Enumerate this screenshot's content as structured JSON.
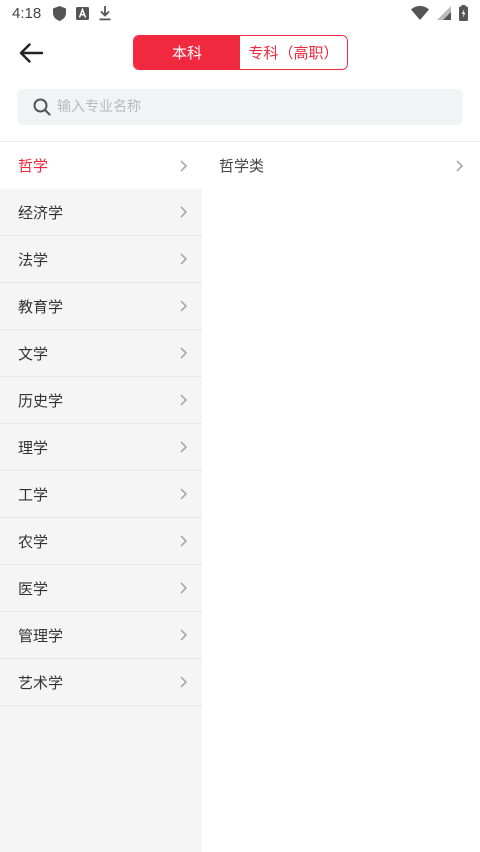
{
  "status_bar": {
    "time": "4:18",
    "left_icons": [
      "shield-icon",
      "a-badge-icon",
      "download-icon"
    ],
    "right_icons": [
      "wifi-icon",
      "signal-icon",
      "battery-icon"
    ]
  },
  "header": {
    "back_icon": "arrow-left-icon",
    "tabs": [
      {
        "label": "本科",
        "active": true
      },
      {
        "label": "专科（高职）",
        "active": false
      }
    ]
  },
  "search": {
    "placeholder": "输入专业名称",
    "value": ""
  },
  "categories": [
    {
      "label": "哲学",
      "selected": true
    },
    {
      "label": "经济学",
      "selected": false
    },
    {
      "label": "法学",
      "selected": false
    },
    {
      "label": "教育学",
      "selected": false
    },
    {
      "label": "文学",
      "selected": false
    },
    {
      "label": "历史学",
      "selected": false
    },
    {
      "label": "理学",
      "selected": false
    },
    {
      "label": "工学",
      "selected": false
    },
    {
      "label": "农学",
      "selected": false
    },
    {
      "label": "医学",
      "selected": false
    },
    {
      "label": "管理学",
      "selected": false
    },
    {
      "label": "艺术学",
      "selected": false
    }
  ],
  "subcategories": [
    {
      "label": "哲学类"
    }
  ],
  "colors": {
    "accent": "#f0293e",
    "left_bg": "#f5f5f5",
    "search_bg": "#f2f3f5"
  }
}
